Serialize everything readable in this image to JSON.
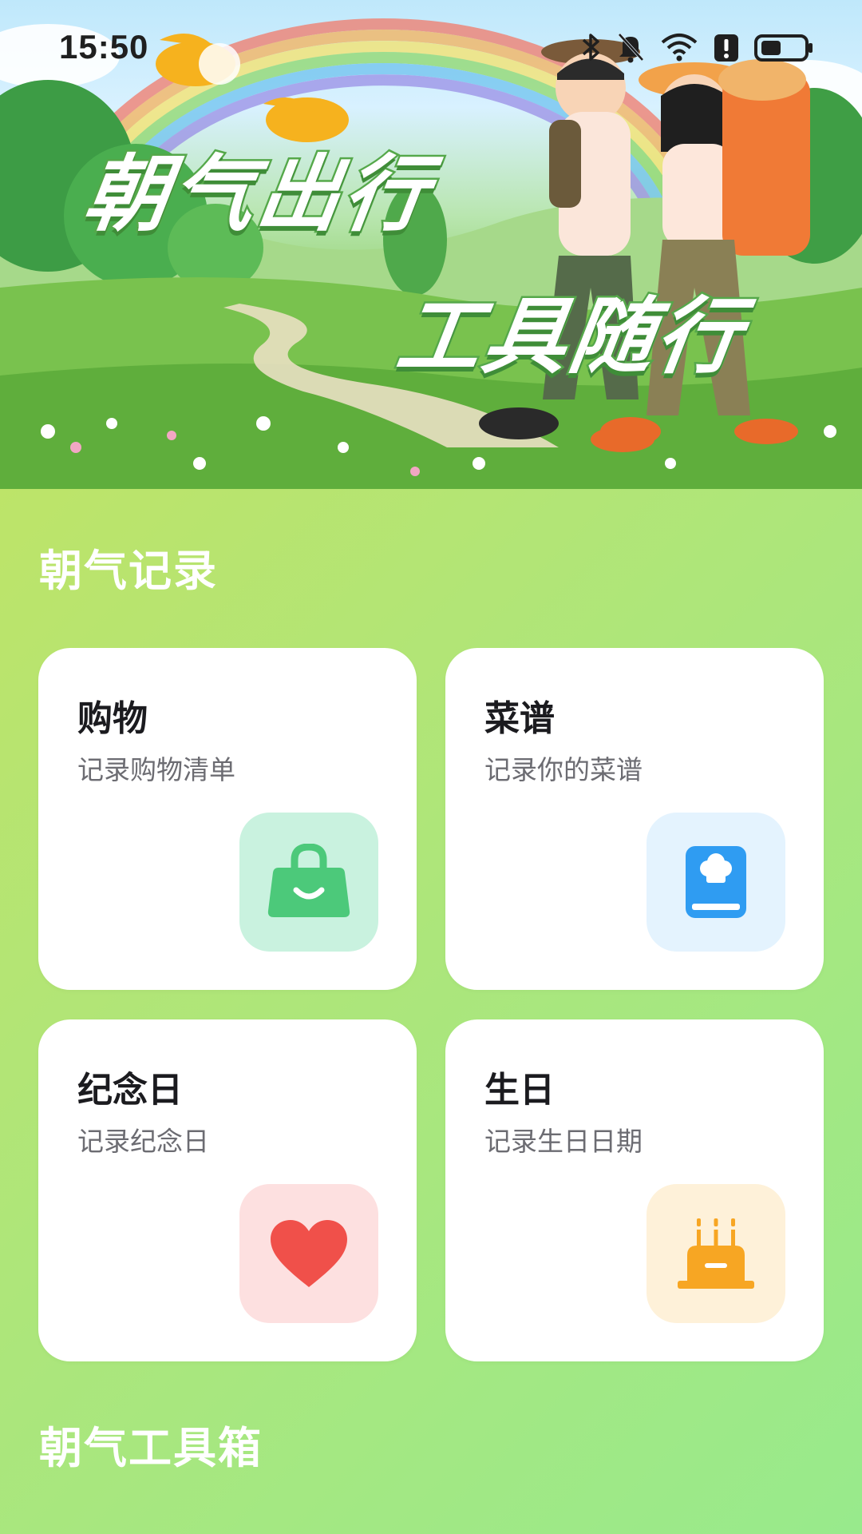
{
  "status_bar": {
    "time": "15:50",
    "icons": [
      "bluetooth-icon",
      "mute-bell-icon",
      "wifi-icon",
      "alert-icon",
      "battery-icon"
    ]
  },
  "hero": {
    "slogan_line1": "朝气出行",
    "slogan_line2": "工具随行"
  },
  "sections": {
    "records_title": "朝气记录",
    "toolbox_title": "朝气工具箱"
  },
  "cards": [
    {
      "title": "购物",
      "subtitle": "记录购物清单",
      "icon": "shopping-bag-icon",
      "icon_bg": "#c9f2df",
      "icon_color": "#4cc97a"
    },
    {
      "title": "菜谱",
      "subtitle": "记录你的菜谱",
      "icon": "recipe-book-icon",
      "icon_bg": "#e4f3fe",
      "icon_color": "#2f9cf2"
    },
    {
      "title": "纪念日",
      "subtitle": "记录纪念日",
      "icon": "heart-icon",
      "icon_bg": "#fde0e0",
      "icon_color": "#f0504a"
    },
    {
      "title": "生日",
      "subtitle": "记录生日日期",
      "icon": "birthday-cake-icon",
      "icon_bg": "#fef1d9",
      "icon_color": "#f7a623"
    }
  ]
}
